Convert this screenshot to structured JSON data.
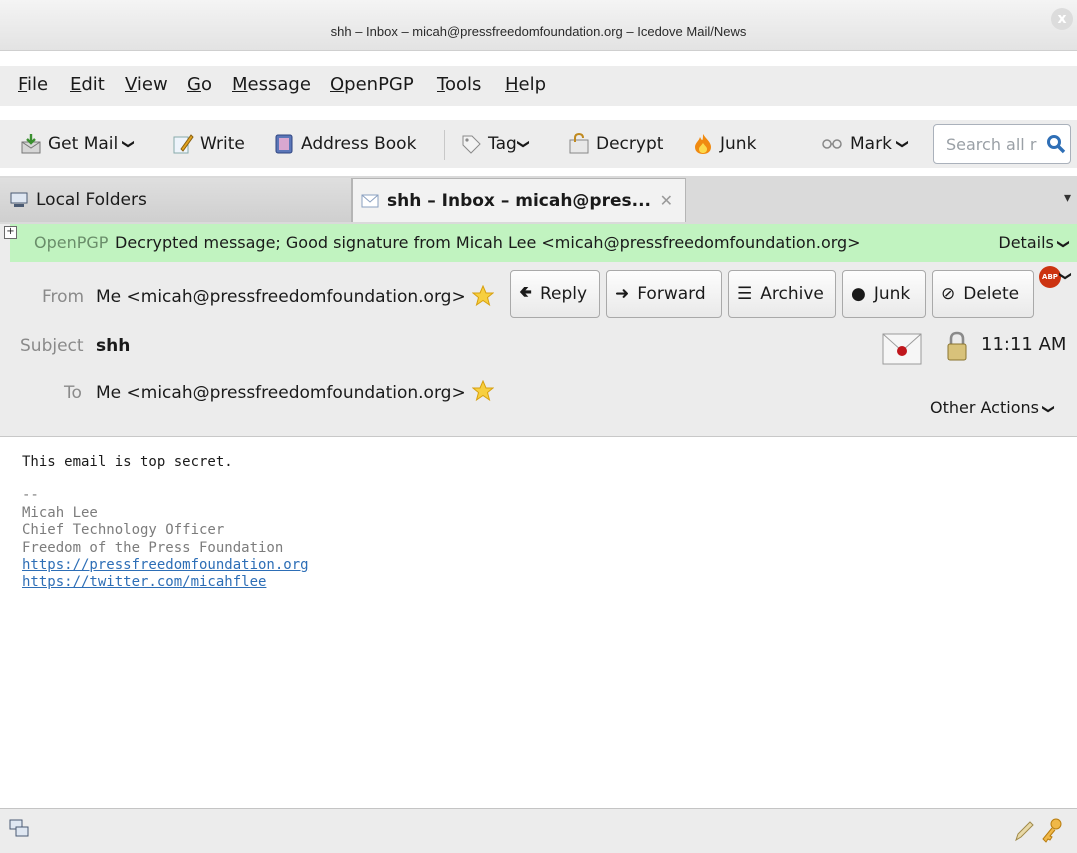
{
  "window": {
    "title": "shh – Inbox – micah@pressfreedomfoundation.org – Icedove Mail/News",
    "close_glyph": "x"
  },
  "menu": [
    {
      "pre": "",
      "u": "F",
      "post": "ile"
    },
    {
      "pre": "",
      "u": "E",
      "post": "dit"
    },
    {
      "pre": "",
      "u": "V",
      "post": "iew"
    },
    {
      "pre": "",
      "u": "G",
      "post": "o"
    },
    {
      "pre": "",
      "u": "M",
      "post": "essage"
    },
    {
      "pre": "",
      "u": "O",
      "post": "penPGP"
    },
    {
      "pre": "",
      "u": "T",
      "post": "ools"
    },
    {
      "pre": "",
      "u": "H",
      "post": "elp"
    }
  ],
  "toolbar": {
    "get_mail": "Get Mail",
    "write": "Write",
    "address_book": "Address Book",
    "tag": "Tag",
    "decrypt": "Decrypt",
    "junk": "Junk",
    "mark": "Mark",
    "search_placeholder": "Search all r",
    "dropdown_glyph": "❯"
  },
  "tabs": {
    "local_folders": "Local Folders",
    "active": "shh – Inbox – micah@pres...",
    "close_glyph": "✕",
    "overflow_glyph": "▾"
  },
  "openpgp": {
    "label": "OpenPGP",
    "message": "Decrypted message; Good signature from Micah Lee <micah@pressfreedomfoundation.org>",
    "details": "Details",
    "expand_glyph": "+"
  },
  "header": {
    "from_label": "From",
    "from_value": "Me <micah@pressfreedomfoundation.org>",
    "subject_label": "Subject",
    "subject_value": "shh",
    "to_label": "To",
    "to_value": "Me <micah@pressfreedomfoundation.org>",
    "time": "11:11 AM",
    "other_actions": "Other Actions",
    "abp": "ABP"
  },
  "actions": {
    "reply": "Reply",
    "forward": "Forward",
    "archive": "Archive",
    "junk": "Junk",
    "delete": "Delete"
  },
  "body": {
    "text": "This email is top secret.",
    "sig_sep": "--",
    "sig_name": "Micah Lee",
    "sig_title": "Chief Technology Officer",
    "sig_org": "Freedom of the Press Foundation",
    "link1": "https://pressfreedomfoundation.org",
    "link2": "https://twitter.com/micahflee"
  }
}
